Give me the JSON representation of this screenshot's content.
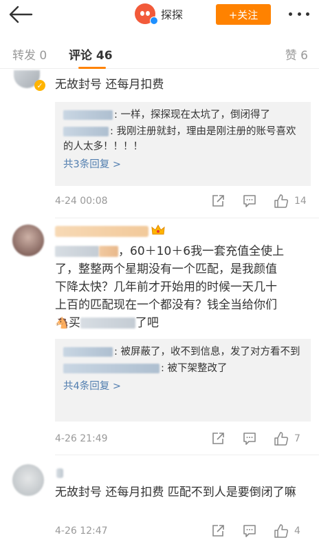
{
  "header": {
    "account_name": "探探",
    "follow_label": "+关注"
  },
  "tabs": {
    "repost": "转发 0",
    "comments": "评论 46",
    "likes": "赞 6"
  },
  "colors": {
    "accent": "#ff8200",
    "link": "#507daf",
    "muted": "#999999",
    "reply_bg": "#f2f2f2"
  },
  "comments": [
    {
      "text": "无故封号  还每月扣费",
      "replies": [
        {
          "text": ": 一样，探探现在太坑了，倒闭得了"
        },
        {
          "text": ": 我刚注册就封，理由是刚注册的账号喜欢的人太多！！！！"
        }
      ],
      "more_replies": "共3条回复 >",
      "time": "4-24 00:08",
      "likes": "14"
    },
    {
      "text_lines": [
        "，60＋10＋6我一套充值全使上",
        "了，整整两个星期没有一个匹配，是我颜值",
        "下降太快？几年前才开始用的时候一天几十",
        "上百的匹配现在一个都没有？钱全当给你们",
        "了吧"
      ],
      "inline_word": "买",
      "replies": [
        {
          "text": ": 被屏蔽了，收不到信息，发了对方看不到"
        },
        {
          "text": ": 被下架整改了"
        }
      ],
      "more_replies": "共4条回复 >",
      "time": "4-26 21:49",
      "likes": "7"
    },
    {
      "text": "无故封号  还每月扣费 匹配不到人是要倒闭了嘛",
      "time": "4-26 12:47",
      "likes": "4"
    }
  ]
}
